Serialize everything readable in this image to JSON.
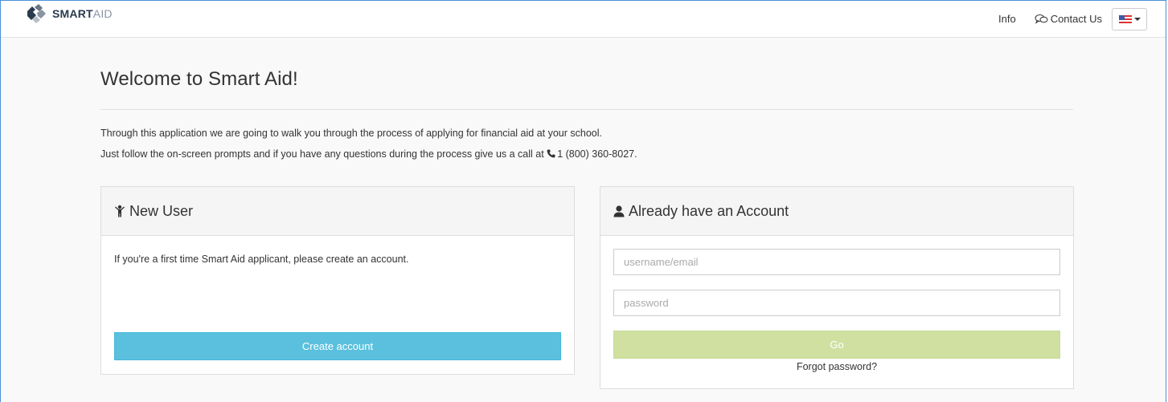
{
  "brand": {
    "strong": "SMART",
    "light": "AID"
  },
  "nav": {
    "info": "Info",
    "contact": "Contact Us",
    "language": "en-US"
  },
  "page": {
    "title": "Welcome to Smart Aid!",
    "intro_line1": "Through this application we are going to walk you through the process of applying for financial aid at your school.",
    "intro_line2_prefix": "Just follow the on-screen prompts and if you have any questions during the process give us a call at",
    "phone": "1 (800) 360-8027."
  },
  "new_user": {
    "heading": "New User",
    "text": "If you're a first time Smart Aid applicant, please create an account.",
    "button": "Create account"
  },
  "login": {
    "heading": "Already have an Account",
    "username_placeholder": "username/email",
    "password_placeholder": "password",
    "button": "Go",
    "forgot": "Forgot password?"
  },
  "colors": {
    "create_button": "#5bc0de",
    "go_button": "#cfe0a1",
    "frame_border": "#4a90d9"
  }
}
